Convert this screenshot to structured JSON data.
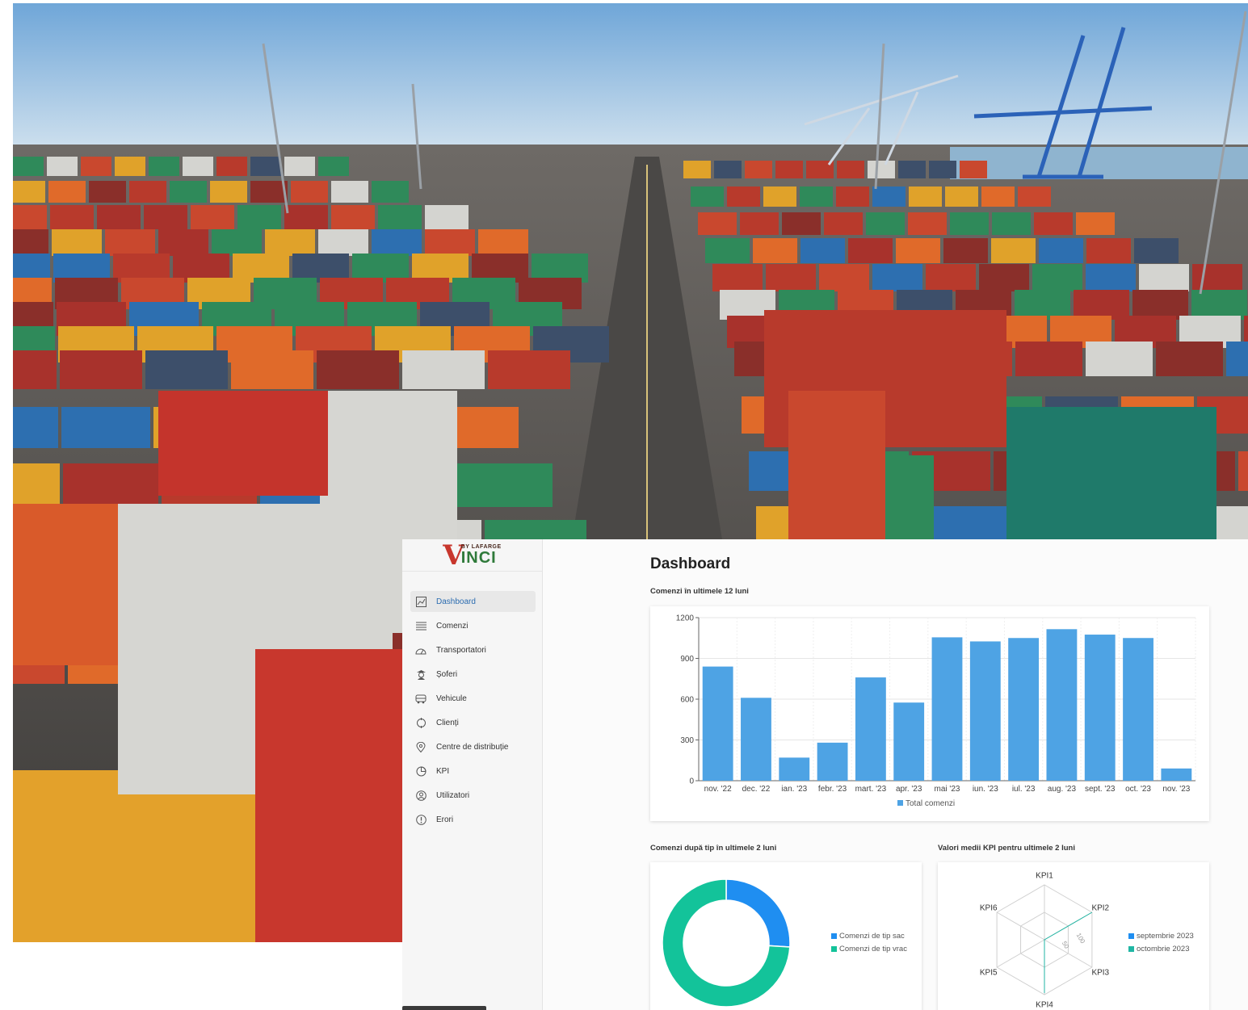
{
  "app": {
    "logo": {
      "top": "BY LAFARGE",
      "v": "V",
      "inci": "INCI"
    }
  },
  "sidebar": {
    "items": [
      {
        "label": "Dashboard",
        "icon": "chart-line-icon",
        "active": true
      },
      {
        "label": "Comenzi",
        "icon": "list-icon",
        "active": false
      },
      {
        "label": "Transportatori",
        "icon": "gauge-icon",
        "active": false
      },
      {
        "label": "Șoferi",
        "icon": "driver-icon",
        "active": false
      },
      {
        "label": "Vehicule",
        "icon": "truck-icon",
        "active": false
      },
      {
        "label": "Clienți",
        "icon": "circle-icon",
        "active": false
      },
      {
        "label": "Centre de distribuție",
        "icon": "location-pin-icon",
        "active": false
      },
      {
        "label": "KPI",
        "icon": "pie-icon",
        "active": false
      },
      {
        "label": "Utilizatori",
        "icon": "user-icon",
        "active": false
      },
      {
        "label": "Erori",
        "icon": "error-icon",
        "active": false
      }
    ]
  },
  "main": {
    "title": "Dashboard",
    "bar_section_title": "Comenzi în ultimele 12 luni",
    "pie_section_title": "Comenzi după tip în ultimele 2 luni",
    "radar_section_title": "Valori medii KPI pentru ultimele 2 luni"
  },
  "colors": {
    "bar": "#4ea3e4",
    "pie_sac": "#1f8ef1",
    "pie_vrac": "#13c39a",
    "radar_sep": "#1f8ef1",
    "radar_oct": "#20b6a4",
    "accent": "#2b6cb0"
  },
  "chart_data": [
    {
      "type": "bar",
      "categories": [
        "nov. '22",
        "dec. '22",
        "ian. '23",
        "febr. '23",
        "mart. '23",
        "apr. '23",
        "mai '23",
        "iun. '23",
        "iul. '23",
        "aug. '23",
        "sept. '23",
        "oct. '23",
        "nov. '23"
      ],
      "series": [
        {
          "name": "Total comenzi",
          "values": [
            840,
            610,
            170,
            280,
            760,
            575,
            1055,
            1025,
            1050,
            1115,
            1075,
            1050,
            90
          ]
        }
      ],
      "yticks": [
        0,
        300,
        600,
        900,
        1200
      ],
      "ylim": [
        0,
        1200
      ],
      "grid": true,
      "legend": "bottom"
    },
    {
      "type": "pie",
      "donut": true,
      "labels": [
        "Comenzi de tip sac",
        "Comenzi de tip vrac"
      ],
      "values": [
        26,
        74
      ],
      "legend": "right"
    },
    {
      "type": "radar",
      "axes": [
        "KPI1",
        "KPI2",
        "KPI3",
        "KPI4",
        "KPI5",
        "KPI6"
      ],
      "rticks": [
        "50",
        "100"
      ],
      "rmax": 100,
      "series": [
        {
          "name": "septembrie 2023",
          "values": [
            0,
            0,
            0,
            0,
            0,
            0
          ]
        },
        {
          "name": "octombrie 2023",
          "values": [
            0,
            100,
            0,
            97,
            0,
            0
          ]
        }
      ],
      "legend": "right"
    }
  ]
}
